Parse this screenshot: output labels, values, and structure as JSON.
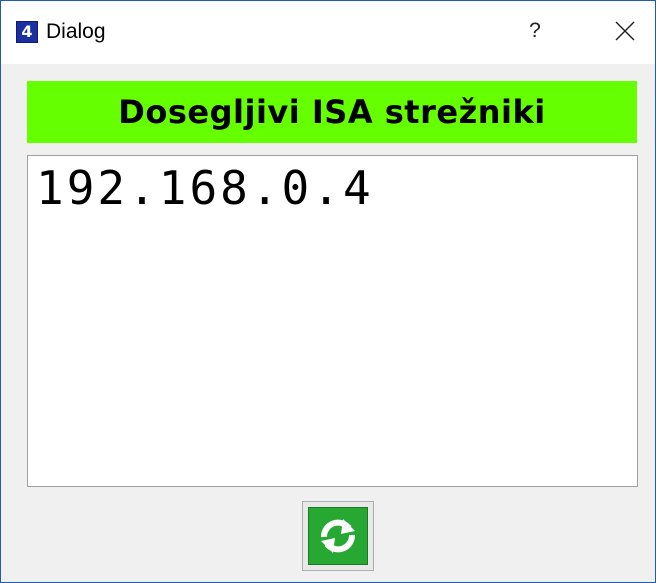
{
  "window": {
    "title": "Dialog",
    "app_icon_label": "4",
    "help_label": "?",
    "close_icon": "close-icon"
  },
  "header": {
    "title": "Dosegljivi ISA strežniki",
    "background_color": "#66ff00"
  },
  "servers": [
    "192.168.0.4"
  ],
  "refresh_button": {
    "icon": "refresh-icon",
    "icon_color": "#27a832"
  }
}
